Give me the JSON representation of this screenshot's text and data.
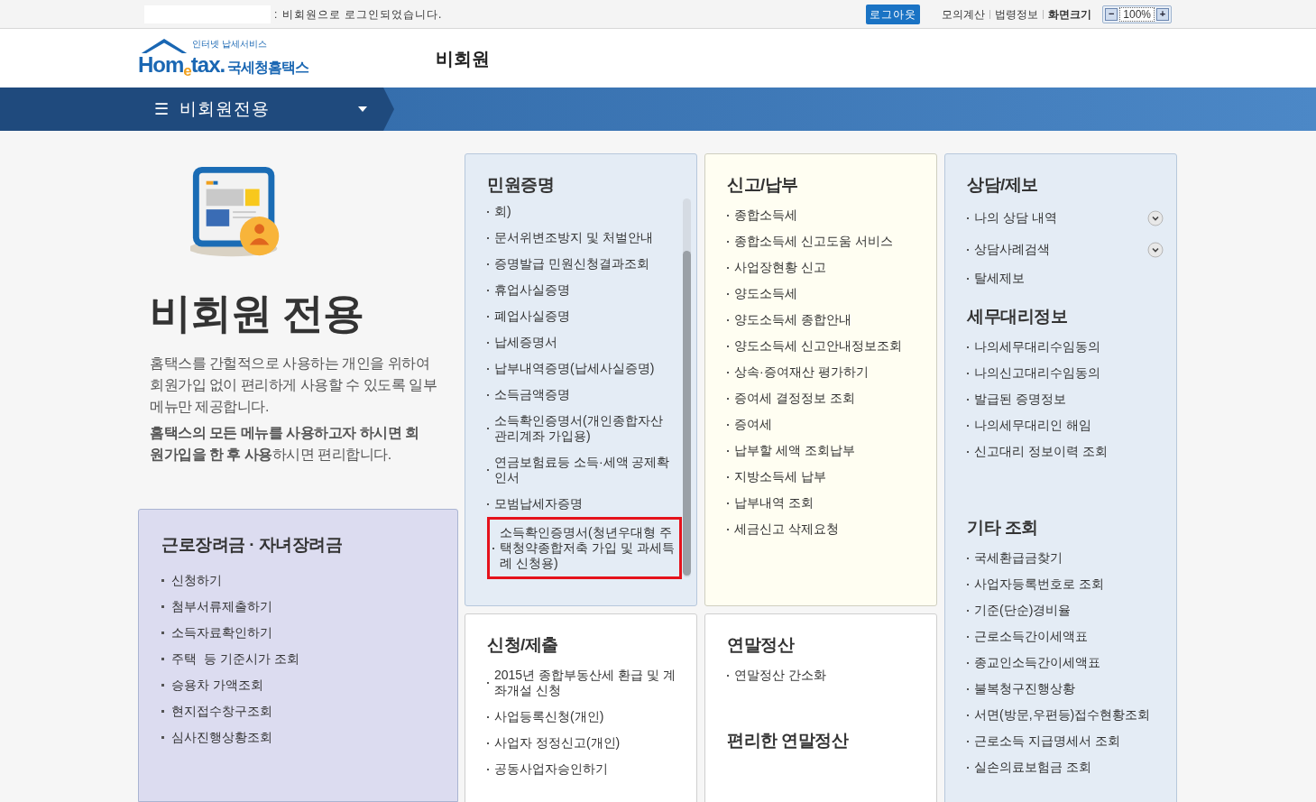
{
  "top_bar": {
    "status": ": 비회원으로 로그인되었습니다.",
    "logout": "로그아웃",
    "links": [
      "모의계산",
      "법령정보",
      "화면크기"
    ],
    "zoom": {
      "minus": "−",
      "value": "100%",
      "plus": "+"
    }
  },
  "header": {
    "logo": {
      "tagline": "인터넷 납세서비스",
      "name": "Hom$_{e}$tax.",
      "korean": "국세청홈택스"
    },
    "title": "비회원"
  },
  "nav": {
    "menu_icon": "☰",
    "label": "비회원전용"
  },
  "intro": {
    "title": "비회원 전용",
    "description": "홈택스를 간헐적으로 사용하는 개인을 위하여 회원가입 없이 편리하게 사용할 수 있도록 일부메뉴만 제공합니다.",
    "note": "**홈택스의 모든 메뉴를 사용하고자 하시면 회원가입을 한 후 사용**하시면 편리합니다."
  },
  "incentive": {
    "title": "근로장려금 · 자녀장려금",
    "items": [
      "신청하기",
      "첨부서류제출하기",
      "소득자료확인하기",
      "주택  등 기준시가 조회",
      "승용차 가액조회",
      "현지접수창구조회",
      "심사진행상황조회"
    ]
  },
  "cards": [
    {
      "sections": [
        {
          "title": "민원증명",
          "items": [
            {
              "label": "회)",
              "highlighted": false
            },
            {
              "label": "문서위변조방지 및 처벌안내",
              "highlighted": false
            },
            {
              "label": "증명발급 민원신청결과조회",
              "highlighted": false
            },
            {
              "label": "휴업사실증명",
              "highlighted": false
            },
            {
              "label": "폐업사실증명",
              "highlighted": false
            },
            {
              "label": "납세증명서",
              "highlighted": false
            },
            {
              "label": "납부내역증명(납세사실증명)",
              "highlighted": false
            },
            {
              "label": "소득금액증명",
              "highlighted": false
            },
            {
              "label": "소득확인증명서(개인종합자산 관리계좌 가입용)",
              "highlighted": false
            },
            {
              "label": "연금보험료등 소득·세액 공제확인서",
              "highlighted": false
            },
            {
              "label": "모범납세자증명",
              "highlighted": false
            },
            {
              "label": "소득확인증명서(청년우대형 주택청약종합저축 가입 및 과세특례 신청용)",
              "highlighted": true
            }
          ]
        }
      ]
    },
    {
      "sections": [
        {
          "title": "신고/납부",
          "items": [
            {
              "label": "종합소득세"
            },
            {
              "label": "종합소득세 신고도움 서비스"
            },
            {
              "label": "사업장현황 신고"
            },
            {
              "label": "양도소득세"
            },
            {
              "label": "양도소득세 종합안내"
            },
            {
              "label": "양도소득세 신고안내정보조회"
            },
            {
              "label": "상속·증여재산 평가하기"
            },
            {
              "label": "증여세 결정정보 조회"
            },
            {
              "label": "증여세"
            },
            {
              "label": "납부할 세액 조회납부"
            },
            {
              "label": "지방소득세 납부"
            },
            {
              "label": "납부내역 조회"
            },
            {
              "label": "세금신고 삭제요청"
            }
          ]
        }
      ]
    },
    {
      "sections": [
        {
          "title": "신청/제출",
          "items": [
            {
              "label": "2015년 종합부동산세 환급 및 계좌개설 신청"
            },
            {
              "label": "사업등록신청(개인)"
            },
            {
              "label": "사업자 정정신고(개인)"
            },
            {
              "label": "공동사업자승인하기"
            }
          ]
        }
      ]
    },
    {
      "sections": [
        {
          "title": "연말정산",
          "items": [
            {
              "label": "연말정산 간소화"
            }
          ]
        },
        {
          "title": "편리한 연말정산"
        }
      ]
    }
  ],
  "side_panel": {
    "sections": [
      {
        "title": "상담/제보",
        "items": [
          {
            "label": "나의 상담 내역",
            "kind": "toggle"
          },
          {
            "label": "상담사례검색",
            "kind": "toggle"
          },
          {
            "label": "탈세제보",
            "kind": "link"
          }
        ]
      },
      {
        "title": "세무대리정보",
        "items": [
          {
            "label": "나의세무대리수임동의"
          },
          {
            "label": "나의신고대리수임동의"
          },
          {
            "label": "발급된 증명정보"
          },
          {
            "label": "나의세무대리인 해임"
          },
          {
            "label": "신고대리 정보이력 조회"
          }
        ]
      },
      {
        "title": "기타 조회",
        "items": [
          {
            "label": "국세환급금찾기"
          },
          {
            "label": "사업자등록번호로 조회"
          },
          {
            "label": "기준(단순)경비율"
          },
          {
            "label": "근로소득간이세액표"
          },
          {
            "label": "종교인소득간이세액표"
          },
          {
            "label": "불복청구진행상황"
          },
          {
            "label": "서면(방문,우편등)접수현황조회"
          },
          {
            "label": "근로소득 지급명세서 조회"
          },
          {
            "label": "실손의료보험금 조회"
          }
        ]
      }
    ]
  }
}
